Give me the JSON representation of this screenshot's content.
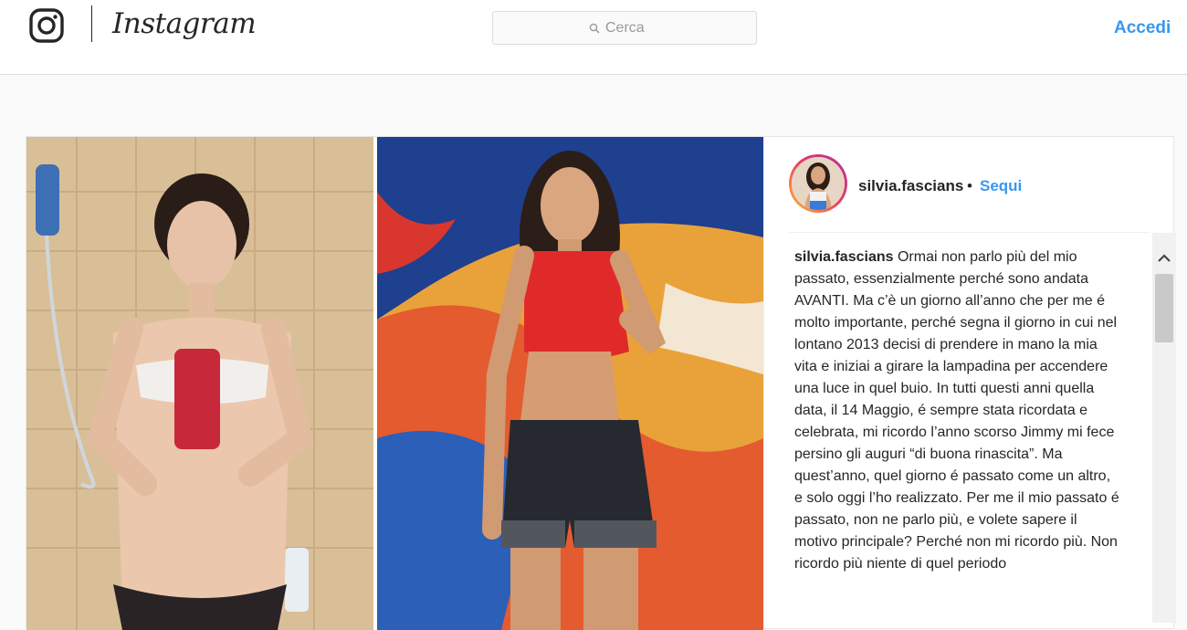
{
  "header": {
    "brand": "Instagram",
    "search_placeholder": "Cerca",
    "login_label": "Accedi"
  },
  "post": {
    "username": "silvia.fascians",
    "separator": "•",
    "follow_label": "Sequi",
    "caption_username": "silvia.fascians",
    "caption_text": "Ormai non parlo più del mio passato, essenzialmente perché sono andata AVANTI. Ma c’è un giorno all’anno che per me é molto importante, perché segna il giorno in cui nel lontano 2013 decisi di prendere in mano la mia vita e iniziai a girare la lampadina per accendere una luce in quel buio. In tutti questi anni quella data, il 14 Maggio, é sempre stata ricordata e celebrata, mi ricordo l’anno scorso Jimmy mi fece persino gli auguri “di buona rinascita”. Ma quest’anno, quel giorno é passato come un altro, e solo oggi l’ho realizzato. Per me il mio passato é passato, non ne parlo più, e volete sapere il motivo principale? Perché non mi ricordo più. Non ricordo più niente di quel periodo"
  },
  "icons": {
    "brand_logo": "instagram-camera-icon",
    "search": "magnifier-icon",
    "scroll_up": "chevron-up-icon"
  },
  "colors": {
    "link_blue": "#3897f0",
    "text": "#262626",
    "border": "#dbdbdb"
  }
}
